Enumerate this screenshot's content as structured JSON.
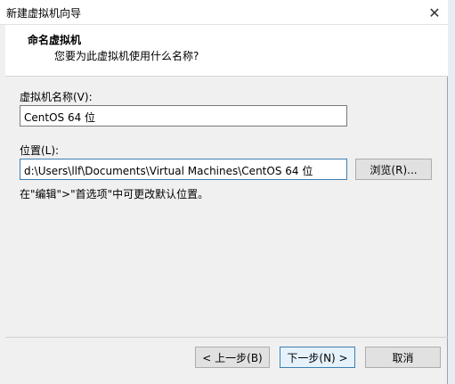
{
  "window": {
    "title": "新建虚拟机向导",
    "close_glyph": "✕"
  },
  "header": {
    "title": "命名虚拟机",
    "subtitle": "您要为此虚拟机使用什么名称?"
  },
  "vm_name": {
    "label": "虚拟机名称(V):",
    "value": "CentOS 64 位"
  },
  "location": {
    "label": "位置(L):",
    "value": "d:\\Users\\llf\\Documents\\Virtual Machines\\CentOS 64 位",
    "browse_label": "浏览(R)..."
  },
  "hint": "在\"编辑\">\"首选项\"中可更改默认位置。",
  "buttons": {
    "back": "< 上一步(B)",
    "next": "下一步(N) >",
    "cancel": "取消"
  },
  "accent_color": "#3c7fb1"
}
